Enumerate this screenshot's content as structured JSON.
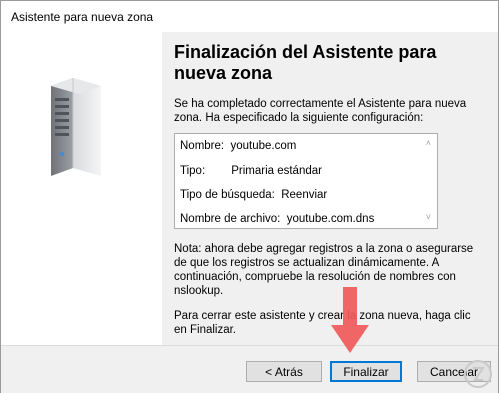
{
  "window": {
    "title": "Asistente para nueva zona"
  },
  "heading": "Finalización del Asistente para nueva zona",
  "intro": "Se ha completado correctamente el Asistente para nueva zona. Ha especificado la siguiente configuración:",
  "config": [
    {
      "label": "Nombre:",
      "value": "youtube.com"
    },
    {
      "label": "Tipo:",
      "value": "Primaria estándar"
    },
    {
      "label": "Tipo de búsqueda:",
      "value": "Reenviar"
    },
    {
      "label": "Nombre de archivo:",
      "value": "youtube.com.dns"
    }
  ],
  "note": "Nota: ahora debe agregar registros a la zona o asegurarse de que los registros se actualizan dinámicamente. A continuación, compruebe la resolución de nombres con nslookup.",
  "close_text": "Para cerrar este asistente y crear la zona nueva, haga clic en Finalizar.",
  "buttons": {
    "back": "< Atrás",
    "finish": "Finalizar",
    "cancel": "Cancelar"
  },
  "colors": {
    "arrow": "#f05a5a",
    "focus_border": "#0078d7"
  },
  "icons": {
    "server": "server-icon",
    "pointer": "red-arrow-pointer"
  }
}
